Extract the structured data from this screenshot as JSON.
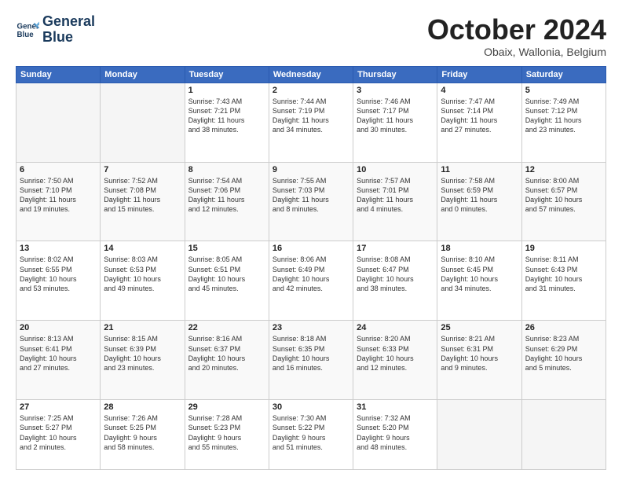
{
  "logo": {
    "line1": "General",
    "line2": "Blue"
  },
  "title": "October 2024",
  "subtitle": "Obaix, Wallonia, Belgium",
  "weekdays": [
    "Sunday",
    "Monday",
    "Tuesday",
    "Wednesday",
    "Thursday",
    "Friday",
    "Saturday"
  ],
  "weeks": [
    [
      {
        "day": "",
        "info": ""
      },
      {
        "day": "",
        "info": ""
      },
      {
        "day": "1",
        "info": "Sunrise: 7:43 AM\nSunset: 7:21 PM\nDaylight: 11 hours\nand 38 minutes."
      },
      {
        "day": "2",
        "info": "Sunrise: 7:44 AM\nSunset: 7:19 PM\nDaylight: 11 hours\nand 34 minutes."
      },
      {
        "day": "3",
        "info": "Sunrise: 7:46 AM\nSunset: 7:17 PM\nDaylight: 11 hours\nand 30 minutes."
      },
      {
        "day": "4",
        "info": "Sunrise: 7:47 AM\nSunset: 7:14 PM\nDaylight: 11 hours\nand 27 minutes."
      },
      {
        "day": "5",
        "info": "Sunrise: 7:49 AM\nSunset: 7:12 PM\nDaylight: 11 hours\nand 23 minutes."
      }
    ],
    [
      {
        "day": "6",
        "info": "Sunrise: 7:50 AM\nSunset: 7:10 PM\nDaylight: 11 hours\nand 19 minutes."
      },
      {
        "day": "7",
        "info": "Sunrise: 7:52 AM\nSunset: 7:08 PM\nDaylight: 11 hours\nand 15 minutes."
      },
      {
        "day": "8",
        "info": "Sunrise: 7:54 AM\nSunset: 7:06 PM\nDaylight: 11 hours\nand 12 minutes."
      },
      {
        "day": "9",
        "info": "Sunrise: 7:55 AM\nSunset: 7:03 PM\nDaylight: 11 hours\nand 8 minutes."
      },
      {
        "day": "10",
        "info": "Sunrise: 7:57 AM\nSunset: 7:01 PM\nDaylight: 11 hours\nand 4 minutes."
      },
      {
        "day": "11",
        "info": "Sunrise: 7:58 AM\nSunset: 6:59 PM\nDaylight: 11 hours\nand 0 minutes."
      },
      {
        "day": "12",
        "info": "Sunrise: 8:00 AM\nSunset: 6:57 PM\nDaylight: 10 hours\nand 57 minutes."
      }
    ],
    [
      {
        "day": "13",
        "info": "Sunrise: 8:02 AM\nSunset: 6:55 PM\nDaylight: 10 hours\nand 53 minutes."
      },
      {
        "day": "14",
        "info": "Sunrise: 8:03 AM\nSunset: 6:53 PM\nDaylight: 10 hours\nand 49 minutes."
      },
      {
        "day": "15",
        "info": "Sunrise: 8:05 AM\nSunset: 6:51 PM\nDaylight: 10 hours\nand 45 minutes."
      },
      {
        "day": "16",
        "info": "Sunrise: 8:06 AM\nSunset: 6:49 PM\nDaylight: 10 hours\nand 42 minutes."
      },
      {
        "day": "17",
        "info": "Sunrise: 8:08 AM\nSunset: 6:47 PM\nDaylight: 10 hours\nand 38 minutes."
      },
      {
        "day": "18",
        "info": "Sunrise: 8:10 AM\nSunset: 6:45 PM\nDaylight: 10 hours\nand 34 minutes."
      },
      {
        "day": "19",
        "info": "Sunrise: 8:11 AM\nSunset: 6:43 PM\nDaylight: 10 hours\nand 31 minutes."
      }
    ],
    [
      {
        "day": "20",
        "info": "Sunrise: 8:13 AM\nSunset: 6:41 PM\nDaylight: 10 hours\nand 27 minutes."
      },
      {
        "day": "21",
        "info": "Sunrise: 8:15 AM\nSunset: 6:39 PM\nDaylight: 10 hours\nand 23 minutes."
      },
      {
        "day": "22",
        "info": "Sunrise: 8:16 AM\nSunset: 6:37 PM\nDaylight: 10 hours\nand 20 minutes."
      },
      {
        "day": "23",
        "info": "Sunrise: 8:18 AM\nSunset: 6:35 PM\nDaylight: 10 hours\nand 16 minutes."
      },
      {
        "day": "24",
        "info": "Sunrise: 8:20 AM\nSunset: 6:33 PM\nDaylight: 10 hours\nand 12 minutes."
      },
      {
        "day": "25",
        "info": "Sunrise: 8:21 AM\nSunset: 6:31 PM\nDaylight: 10 hours\nand 9 minutes."
      },
      {
        "day": "26",
        "info": "Sunrise: 8:23 AM\nSunset: 6:29 PM\nDaylight: 10 hours\nand 5 minutes."
      }
    ],
    [
      {
        "day": "27",
        "info": "Sunrise: 7:25 AM\nSunset: 5:27 PM\nDaylight: 10 hours\nand 2 minutes."
      },
      {
        "day": "28",
        "info": "Sunrise: 7:26 AM\nSunset: 5:25 PM\nDaylight: 9 hours\nand 58 minutes."
      },
      {
        "day": "29",
        "info": "Sunrise: 7:28 AM\nSunset: 5:23 PM\nDaylight: 9 hours\nand 55 minutes."
      },
      {
        "day": "30",
        "info": "Sunrise: 7:30 AM\nSunset: 5:22 PM\nDaylight: 9 hours\nand 51 minutes."
      },
      {
        "day": "31",
        "info": "Sunrise: 7:32 AM\nSunset: 5:20 PM\nDaylight: 9 hours\nand 48 minutes."
      },
      {
        "day": "",
        "info": ""
      },
      {
        "day": "",
        "info": ""
      }
    ]
  ]
}
